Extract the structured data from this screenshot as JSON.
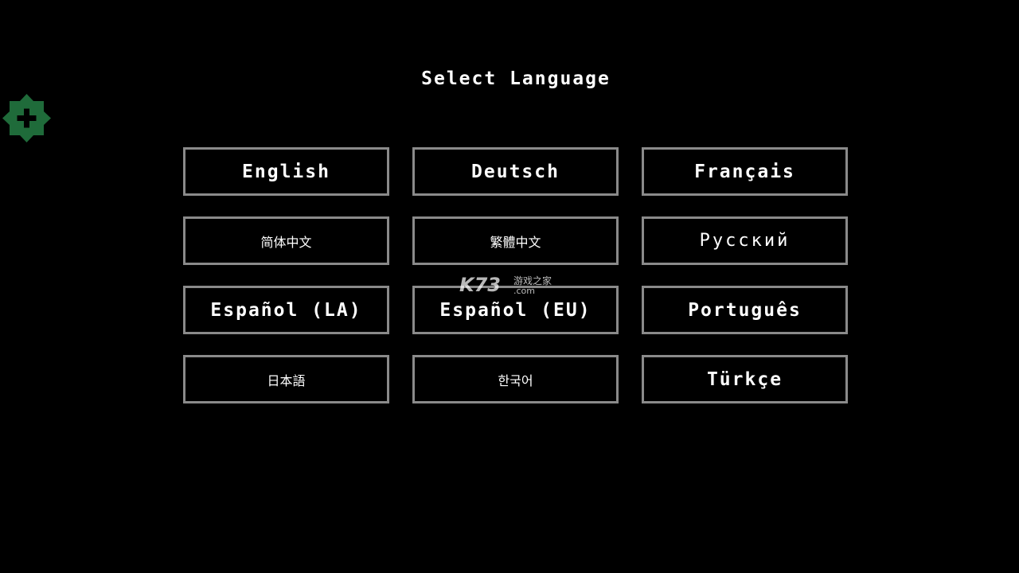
{
  "screen": {
    "title": "Select Language",
    "background_color": "#000000"
  },
  "add_badge": {
    "icon": "plus-icon",
    "color": "#1f6b3a"
  },
  "languages": [
    {
      "label": "English",
      "script": "latin"
    },
    {
      "label": "Deutsch",
      "script": "latin"
    },
    {
      "label": "Français",
      "script": "latin"
    },
    {
      "label": "简体中文",
      "script": "cjk"
    },
    {
      "label": "繁體中文",
      "script": "cjk"
    },
    {
      "label": "Русский",
      "script": "cyr"
    },
    {
      "label": "Español (LA)",
      "script": "latin"
    },
    {
      "label": "Español (EU)",
      "script": "latin"
    },
    {
      "label": "Português",
      "script": "latin"
    },
    {
      "label": "日本語",
      "script": "cjk"
    },
    {
      "label": "한국어",
      "script": "cjk"
    },
    {
      "label": "Türkçe",
      "script": "latin"
    }
  ],
  "button_border_color": "#8a8a8a",
  "watermark": {
    "brand": "K73",
    "tagline": "游戏之家",
    "domain": ".com"
  }
}
